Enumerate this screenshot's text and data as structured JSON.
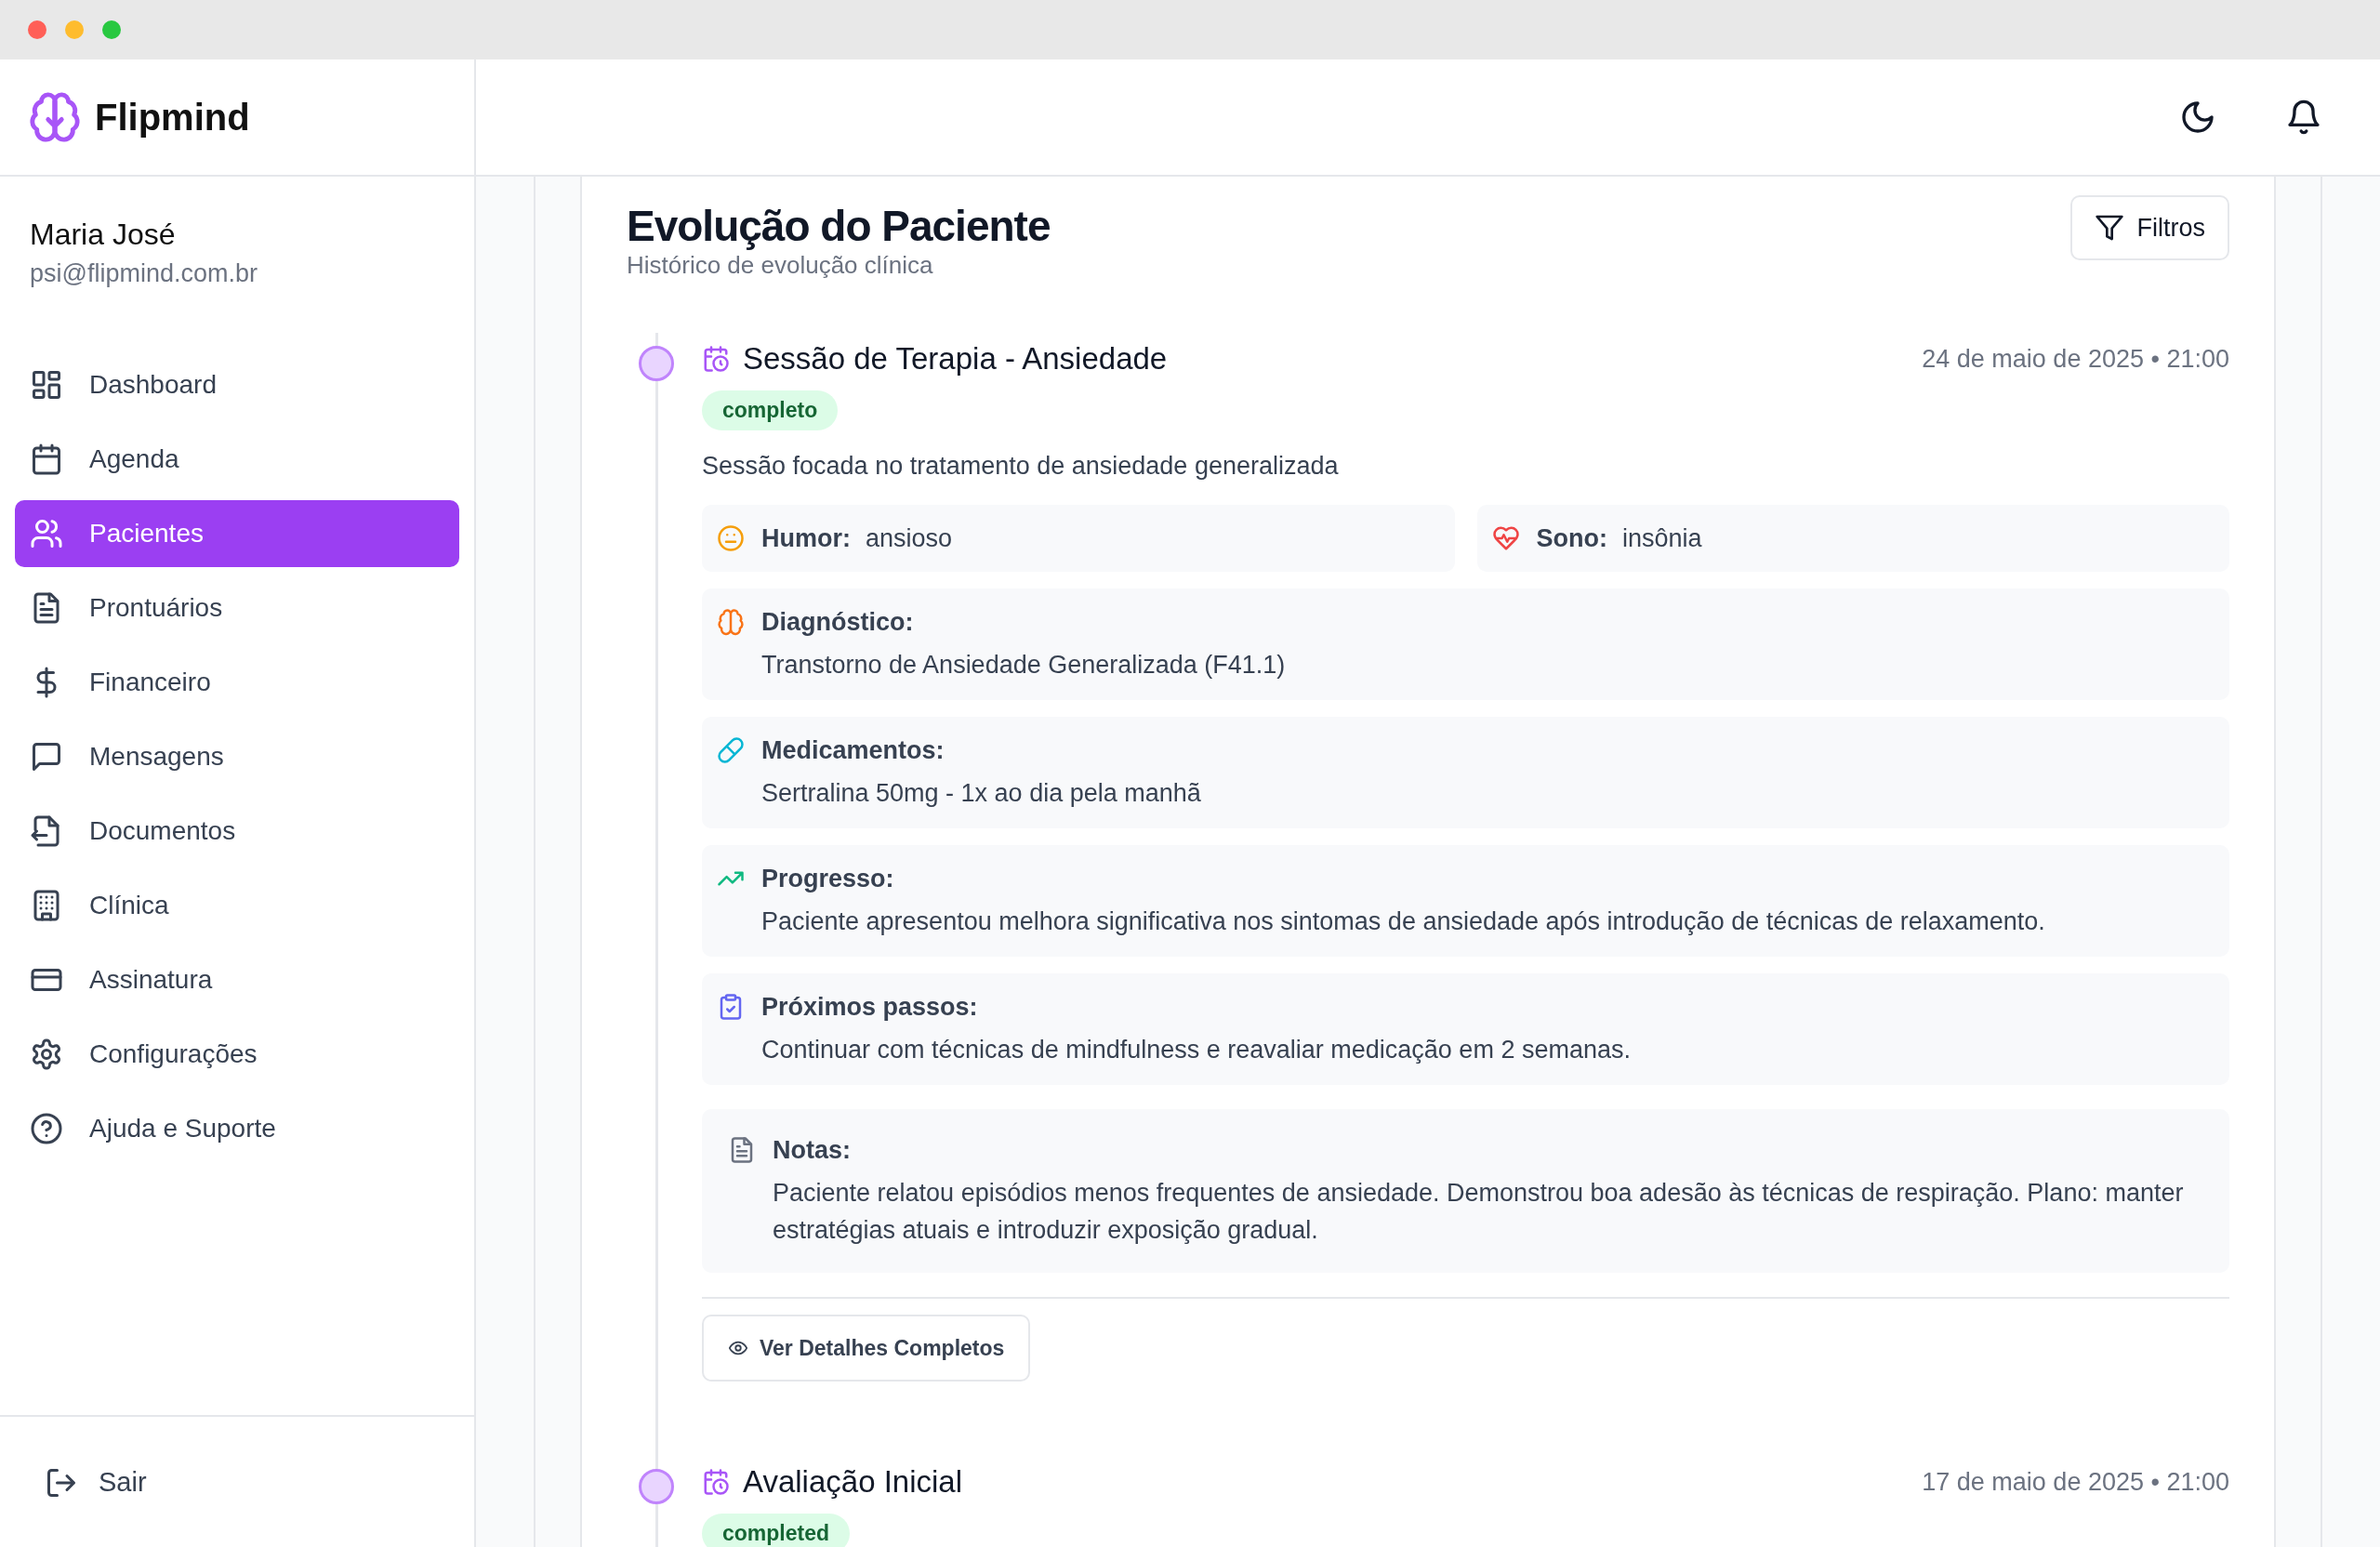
{
  "app": {
    "name": "Flipmind"
  },
  "user": {
    "name": "Maria José",
    "email": "psi@flipmind.com.br"
  },
  "sidebar": {
    "items": [
      {
        "label": "Dashboard",
        "selected": false
      },
      {
        "label": "Agenda",
        "selected": false
      },
      {
        "label": "Pacientes",
        "selected": true
      },
      {
        "label": "Prontuários",
        "selected": false
      },
      {
        "label": "Financeiro",
        "selected": false
      },
      {
        "label": "Mensagens",
        "selected": false
      },
      {
        "label": "Documentos",
        "selected": false
      },
      {
        "label": "Clínica",
        "selected": false
      },
      {
        "label": "Assinatura",
        "selected": false
      },
      {
        "label": "Configurações",
        "selected": false
      },
      {
        "label": "Ajuda e Suporte",
        "selected": false
      }
    ],
    "logout": "Sair"
  },
  "page": {
    "title": "Evolução do Paciente",
    "subtitle": "Histórico de evolução clínica",
    "filter_button": "Filtros"
  },
  "entries": [
    {
      "title": "Sessão de Terapia - Ansiedade",
      "status": "completo",
      "date": "24 de maio de 2025 • 21:00",
      "description": "Sessão focada no tratamento de ansiedade generalizada",
      "vitals": [
        {
          "kind": "mood",
          "label": "Humor:",
          "value": "ansioso"
        },
        {
          "kind": "sleep",
          "label": "Sono:",
          "value": "insônia"
        }
      ],
      "sections": [
        {
          "kind": "diagnosis",
          "label": "Diagnóstico:",
          "text": "Transtorno de Ansiedade Generalizada (F41.1)"
        },
        {
          "kind": "medication",
          "label": "Medicamentos:",
          "text": "Sertralina 50mg - 1x ao dia pela manhã"
        },
        {
          "kind": "progress",
          "label": "Progresso:",
          "text": "Paciente apresentou melhora significativa nos sintomas de ansiedade após introdução de técnicas de relaxamento."
        },
        {
          "kind": "next",
          "label": "Próximos passos:",
          "text": "Continuar com técnicas de mindfulness e reavaliar medicação em 2 semanas."
        },
        {
          "kind": "notes",
          "label": "Notas:",
          "text": "Paciente relatou episódios menos frequentes de ansiedade. Demonstrou boa adesão às técnicas de respiração. Plano: manter estratégias atuais e introduzir exposição gradual."
        }
      ],
      "action": "Ver Detalhes Completos"
    },
    {
      "title": "Avaliação Inicial",
      "status": "completed",
      "date": "17 de maio de 2025 • 21:00"
    }
  ]
}
